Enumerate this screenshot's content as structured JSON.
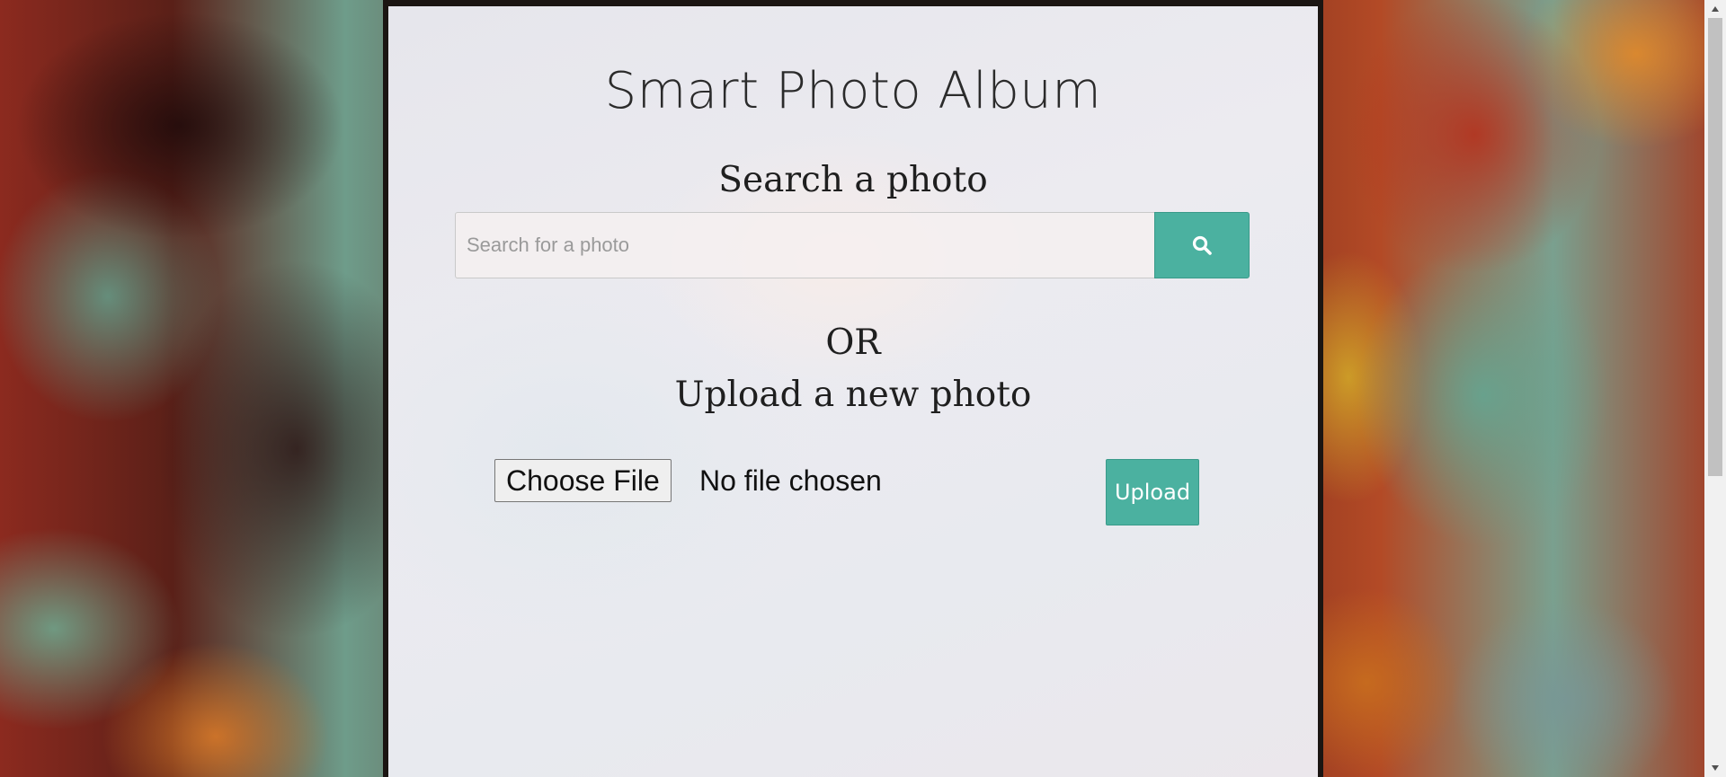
{
  "app": {
    "title": "Smart Photo Album"
  },
  "search": {
    "heading": "Search a photo",
    "placeholder": "Search for a photo",
    "button_icon": "search-icon"
  },
  "divider": {
    "text": "OR"
  },
  "upload": {
    "heading": "Upload a new photo",
    "choose_label": "Choose File",
    "file_status": "No file chosen",
    "upload_label": "Upload"
  },
  "colors": {
    "accent": "#4bb1a0",
    "panel_border": "#1b1512"
  }
}
